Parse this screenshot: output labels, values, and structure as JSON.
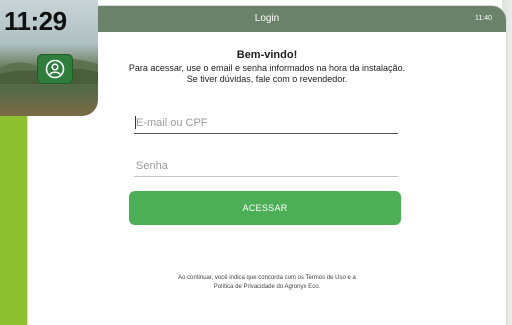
{
  "lockscreen": {
    "time": "11:29",
    "avatar_icon": "user-icon"
  },
  "app": {
    "title": "Login",
    "status_time": "11:40",
    "accent_color": "#4caf55",
    "header_color": "#6a8269"
  },
  "welcome": {
    "heading": "Bem-vindo!",
    "line1": "Para acessar, use o email e senha informados na hora da instalação.",
    "line2": "Se tiver dúvidas, fale com o revendedor."
  },
  "form": {
    "email_placeholder": "E-mail ou CPF",
    "password_placeholder": "Senha",
    "submit_label": "ACESSAR"
  },
  "terms": {
    "line1": "Ao continuar, você indica que concorda com os Termos de Uso e a",
    "line2": "Política de Privacidade do Agronyx Eco."
  }
}
